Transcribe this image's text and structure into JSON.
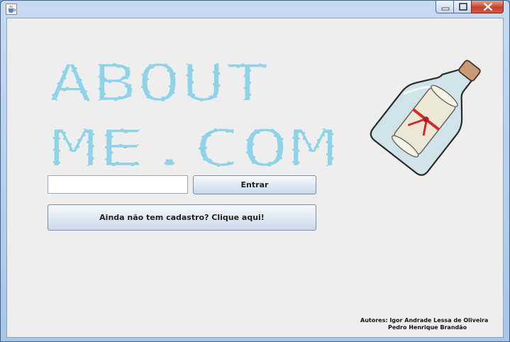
{
  "window": {
    "controls": {
      "minimize_icon": "minimize-icon",
      "maximize_icon": "maximize-icon",
      "close_icon": "close-icon"
    },
    "app_icon": "java-coffee-cup-icon"
  },
  "logo": {
    "line1": "ABOUT",
    "line2": "ME.COM",
    "color": "#8fd3e8"
  },
  "login": {
    "input_value": "",
    "enter_label": "Entrar"
  },
  "signup": {
    "label": "Ainda não tem cadastro? Clique aqui!"
  },
  "authors": {
    "line1": "Autores: Igor Andrade Lessa de Oliveira",
    "line2": "Pedro Henrique Brandão"
  },
  "illustration": {
    "icon": "message-in-a-bottle-icon"
  }
}
